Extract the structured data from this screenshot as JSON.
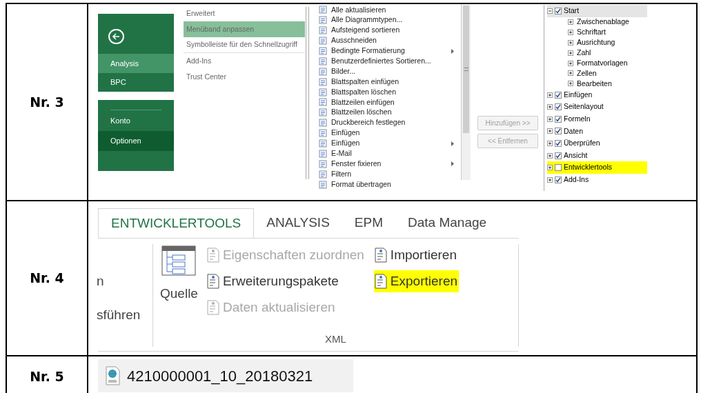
{
  "rows": [
    {
      "label": "Nr. 3",
      "kind": "options"
    },
    {
      "label": "Nr. 4",
      "kind": "ribbon"
    },
    {
      "label": "Nr. 5",
      "kind": "file"
    }
  ],
  "backstage": {
    "groups": [
      {
        "back_button": true,
        "items": [
          {
            "label": "Analysis",
            "selected": true
          },
          {
            "label": "BPC",
            "selected": false
          }
        ]
      },
      {
        "back_button": false,
        "items": [
          {
            "label": "Konto",
            "selected": false
          },
          {
            "label": "Optionen",
            "selected": true
          }
        ]
      }
    ]
  },
  "option_categories": [
    {
      "label": "Erweitert",
      "selected": false
    },
    {
      "label": "Menüband anpassen",
      "selected": true
    },
    {
      "label": "Symbolleiste für den Schnellzugriff",
      "selected": false
    },
    {
      "label": "Add-Ins",
      "selected": false
    },
    {
      "label": "Trust Center",
      "selected": false
    }
  ],
  "commands": [
    {
      "label": "Alle aktualisieren",
      "submenu": false
    },
    {
      "label": "Alle Diagrammtypen...",
      "submenu": false
    },
    {
      "label": "Aufsteigend sortieren",
      "submenu": false
    },
    {
      "label": "Ausschneiden",
      "submenu": false
    },
    {
      "label": "Bedingte Formatierung",
      "submenu": true
    },
    {
      "label": "Benutzerdefiniertes Sortieren...",
      "submenu": false
    },
    {
      "label": "Bilder...",
      "submenu": false
    },
    {
      "label": "Blattspalten einfügen",
      "submenu": false
    },
    {
      "label": "Blattspalten löschen",
      "submenu": false
    },
    {
      "label": "Blattzeilen einfügen",
      "submenu": false
    },
    {
      "label": "Blattzeilen löschen",
      "submenu": false
    },
    {
      "label": "Druckbereich festlegen",
      "submenu": false
    },
    {
      "label": "Einfügen",
      "submenu": false
    },
    {
      "label": "Einfügen",
      "submenu": true
    },
    {
      "label": "E-Mail",
      "submenu": false
    },
    {
      "label": "Fenster fixieren",
      "submenu": true
    },
    {
      "label": "Filtern",
      "submenu": false
    },
    {
      "label": "Format übertragen",
      "submenu": false
    }
  ],
  "transfer_buttons": [
    {
      "label": "Hinzufügen >>",
      "disabled": true
    },
    {
      "label": "<< Entfernen",
      "disabled": true
    }
  ],
  "ribbon_tree": [
    {
      "label": "Start",
      "checked": true,
      "expanded": true,
      "selected": true,
      "highlighted": false,
      "children": [
        {
          "label": "Zwischenablage"
        },
        {
          "label": "Schriftart"
        },
        {
          "label": "Ausrichtung"
        },
        {
          "label": "Zahl"
        },
        {
          "label": "Formatvorlagen"
        },
        {
          "label": "Zellen"
        },
        {
          "label": "Bearbeiten"
        }
      ]
    },
    {
      "label": "Einfügen",
      "checked": true,
      "expanded": false,
      "selected": false,
      "highlighted": false
    },
    {
      "label": "Seitenlayout",
      "checked": true,
      "expanded": false,
      "selected": false,
      "highlighted": false
    },
    {
      "label": "Formeln",
      "checked": true,
      "expanded": false,
      "selected": false,
      "highlighted": false
    },
    {
      "label": "Daten",
      "checked": true,
      "expanded": false,
      "selected": false,
      "highlighted": false
    },
    {
      "label": "Überprüfen",
      "checked": true,
      "expanded": false,
      "selected": false,
      "highlighted": false
    },
    {
      "label": "Ansicht",
      "checked": true,
      "expanded": false,
      "selected": false,
      "highlighted": false
    },
    {
      "label": "Entwicklertools",
      "checked": false,
      "expanded": false,
      "selected": false,
      "highlighted": true
    },
    {
      "label": "Add-Ins",
      "checked": true,
      "expanded": false,
      "selected": false,
      "highlighted": false
    }
  ],
  "ribbon": {
    "tabs": [
      {
        "label": "ENTWICKLERTOOLS",
        "selected": true
      },
      {
        "label": "ANALYSIS",
        "selected": false
      },
      {
        "label": "EPM",
        "selected": false
      },
      {
        "label": "Data Manage",
        "selected": false
      }
    ],
    "cut_group": [
      "n",
      "sführen"
    ],
    "source_button": {
      "label": "Quelle"
    },
    "columns": [
      [
        {
          "label": "Eigenschaften zuordnen",
          "disabled": true,
          "highlighted": false
        },
        {
          "label": "Erweiterungspakete",
          "disabled": false,
          "highlighted": false
        },
        {
          "label": "Daten aktualisieren",
          "disabled": true,
          "highlighted": false
        }
      ],
      [
        {
          "label": "Importieren",
          "disabled": false,
          "highlighted": false
        },
        {
          "label": "Exportieren",
          "disabled": false,
          "highlighted": true
        }
      ]
    ],
    "group_label": "XML"
  },
  "file": {
    "name": "4210000001_10_20180321"
  }
}
